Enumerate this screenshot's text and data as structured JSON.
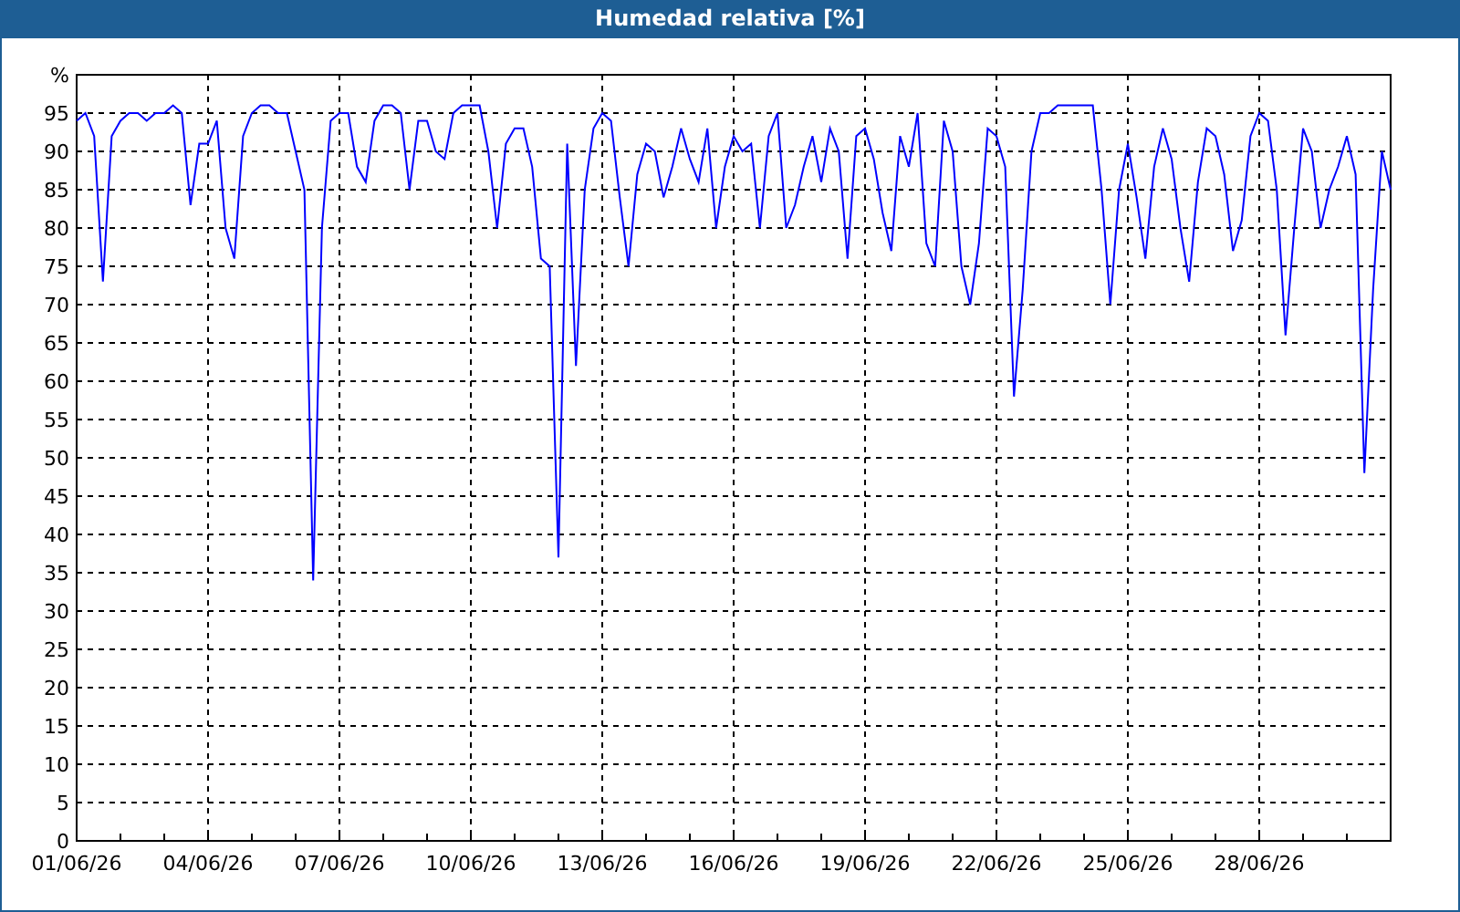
{
  "window": {
    "title": "Humedad relativa [%]"
  },
  "chart": {
    "chart_data": {
      "type": "line",
      "categories": [
        "01/06/26",
        null,
        null,
        null,
        null,
        null,
        null,
        null,
        null,
        null,
        null,
        null,
        null,
        null,
        null,
        "04/06/26",
        null,
        null,
        null,
        null,
        null,
        null,
        null,
        null,
        null,
        null,
        null,
        null,
        null,
        null,
        "07/06/26",
        null,
        null,
        null,
        null,
        null,
        null,
        null,
        null,
        null,
        null,
        null,
        null,
        null,
        null,
        "10/06/26",
        null,
        null,
        null,
        null,
        null,
        null,
        null,
        null,
        null,
        null,
        null,
        null,
        null,
        null,
        "13/06/26",
        null,
        null,
        null,
        null,
        null,
        null,
        null,
        null,
        null,
        null,
        null,
        null,
        null,
        null,
        "16/06/26",
        null,
        null,
        null,
        null,
        null,
        null,
        null,
        null,
        null,
        null,
        null,
        null,
        null,
        null,
        "19/06/26",
        null,
        null,
        null,
        null,
        null,
        null,
        null,
        null,
        null,
        null,
        null,
        null,
        null,
        null,
        "22/06/26",
        null,
        null,
        null,
        null,
        null,
        null,
        null,
        null,
        null,
        null,
        null,
        null,
        null,
        null,
        "25/06/26",
        null,
        null,
        null,
        null,
        null,
        null,
        null,
        null,
        null,
        null,
        null,
        null,
        null,
        null,
        "28/06/26",
        null,
        null,
        null,
        null,
        null,
        null,
        null,
        null,
        null,
        null,
        null,
        null,
        null,
        null,
        null
      ],
      "series": [
        {
          "color": "#0000ff",
          "values": [
            94,
            95,
            92,
            73,
            92,
            94,
            95,
            95,
            94,
            95,
            95,
            96,
            95,
            83,
            91,
            91,
            94,
            80,
            76,
            92,
            95,
            96,
            96,
            95,
            95,
            90,
            85,
            34,
            80,
            94,
            95,
            95,
            88,
            86,
            94,
            96,
            96,
            95,
            85,
            94,
            94,
            90,
            89,
            95,
            96,
            96,
            96,
            90,
            80,
            91,
            93,
            93,
            88,
            76,
            75,
            37,
            91,
            62,
            85,
            93,
            95,
            94,
            84,
            75,
            87,
            91,
            90,
            84,
            88,
            93,
            89,
            86,
            93,
            80,
            88,
            92,
            90,
            91,
            80,
            92,
            95,
            80,
            83,
            88,
            92,
            86,
            93,
            90,
            76,
            92,
            93,
            89,
            82,
            77,
            92,
            88,
            95,
            78,
            75,
            94,
            90,
            75,
            70,
            78,
            93,
            92,
            88,
            58,
            72,
            90,
            95,
            95,
            96,
            96,
            96,
            96,
            96,
            85,
            70,
            85,
            91,
            84,
            76,
            88,
            93,
            89,
            80,
            73,
            86,
            93,
            92,
            87,
            77,
            81,
            92,
            95,
            94,
            85,
            66,
            80,
            93,
            90,
            80,
            85,
            88,
            92,
            87,
            48,
            72,
            90,
            85
          ]
        }
      ],
      "grid": true,
      "ylim": [
        0,
        100
      ],
      "yticks": [
        0,
        5,
        10,
        15,
        20,
        25,
        30,
        35,
        40,
        45,
        50,
        55,
        60,
        65,
        70,
        75,
        80,
        85,
        90,
        95,
        {
          "value": 100,
          "label": "%"
        }
      ]
    }
  }
}
